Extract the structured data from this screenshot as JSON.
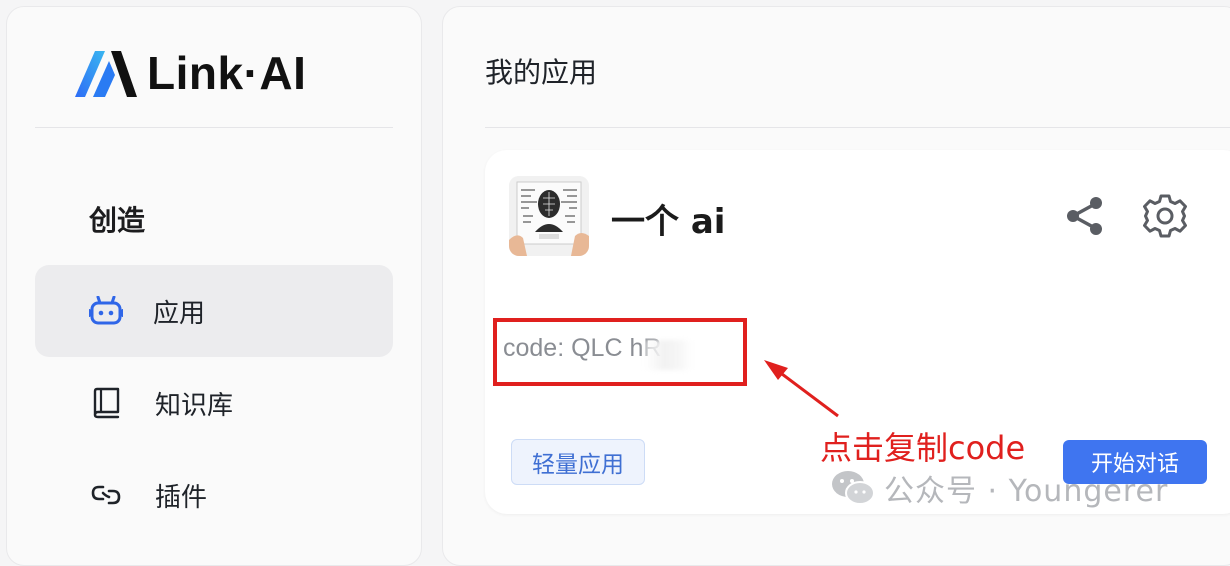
{
  "brand": {
    "logo_text": "Link·AI"
  },
  "sidebar": {
    "section_title": "创造",
    "items": [
      {
        "label": "应用",
        "icon": "robot-icon",
        "active": true
      },
      {
        "label": "知识库",
        "icon": "book-icon",
        "active": false
      },
      {
        "label": "插件",
        "icon": "link-icon",
        "active": false
      }
    ]
  },
  "main": {
    "title": "我的应用",
    "app_card": {
      "name": "一个 ai",
      "code_text": "code: QLC         hR",
      "tag": "轻量应用",
      "start_button": "开始对话",
      "icons": [
        "share-icon",
        "settings-icon"
      ]
    }
  },
  "annotation": {
    "text": "点击复制code",
    "color": "#e0201e"
  },
  "watermark": {
    "text": "公众号 · Youngerer"
  },
  "colors": {
    "accent": "#3f75f0",
    "annotation": "#e0201e",
    "tag_text": "#3f6fd3"
  }
}
